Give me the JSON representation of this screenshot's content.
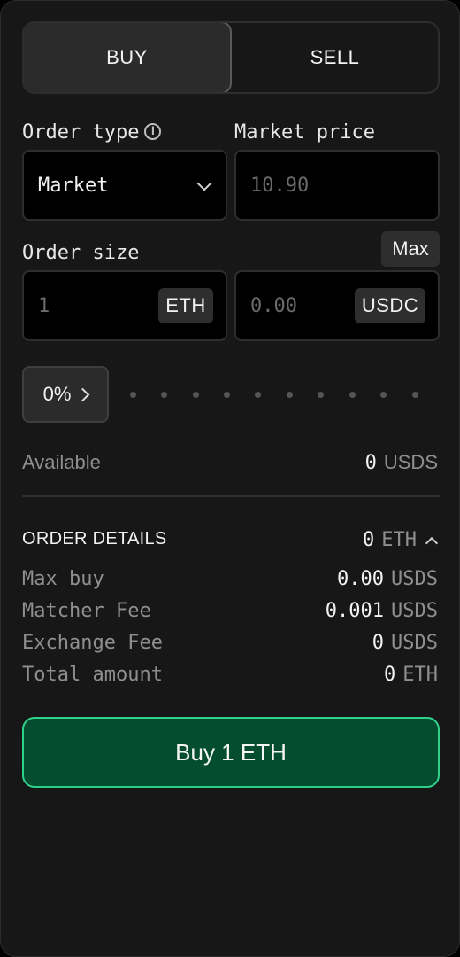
{
  "tabs": {
    "buy": "BUY",
    "sell": "SELL",
    "active": "buy"
  },
  "order_type": {
    "label": "Order type",
    "value": "Market"
  },
  "market_price": {
    "label": "Market price",
    "placeholder": "10.90"
  },
  "order_size": {
    "label": "Order size",
    "max_label": "Max",
    "base": {
      "placeholder": "1",
      "token": "ETH"
    },
    "quote": {
      "placeholder": "0.00",
      "token": "USDC"
    }
  },
  "percent": {
    "value": "0%",
    "steps": 10
  },
  "available": {
    "label": "Available",
    "value": "0",
    "unit": "USDS"
  },
  "order_details": {
    "title": "ORDER DETAILS",
    "summary_value": "0",
    "summary_unit": "ETH",
    "rows": [
      {
        "label": "Max buy",
        "value": "0.00",
        "unit": "USDS"
      },
      {
        "label": "Matcher Fee",
        "value": "0.001",
        "unit": "USDS"
      },
      {
        "label": "Exchange Fee",
        "value": "0",
        "unit": "USDS"
      },
      {
        "label": "Total amount",
        "value": "0",
        "unit": "ETH"
      }
    ]
  },
  "submit": {
    "label": "Buy 1 ETH"
  },
  "colors": {
    "accent": "#2fd08a",
    "button_bg": "#044d2e"
  }
}
